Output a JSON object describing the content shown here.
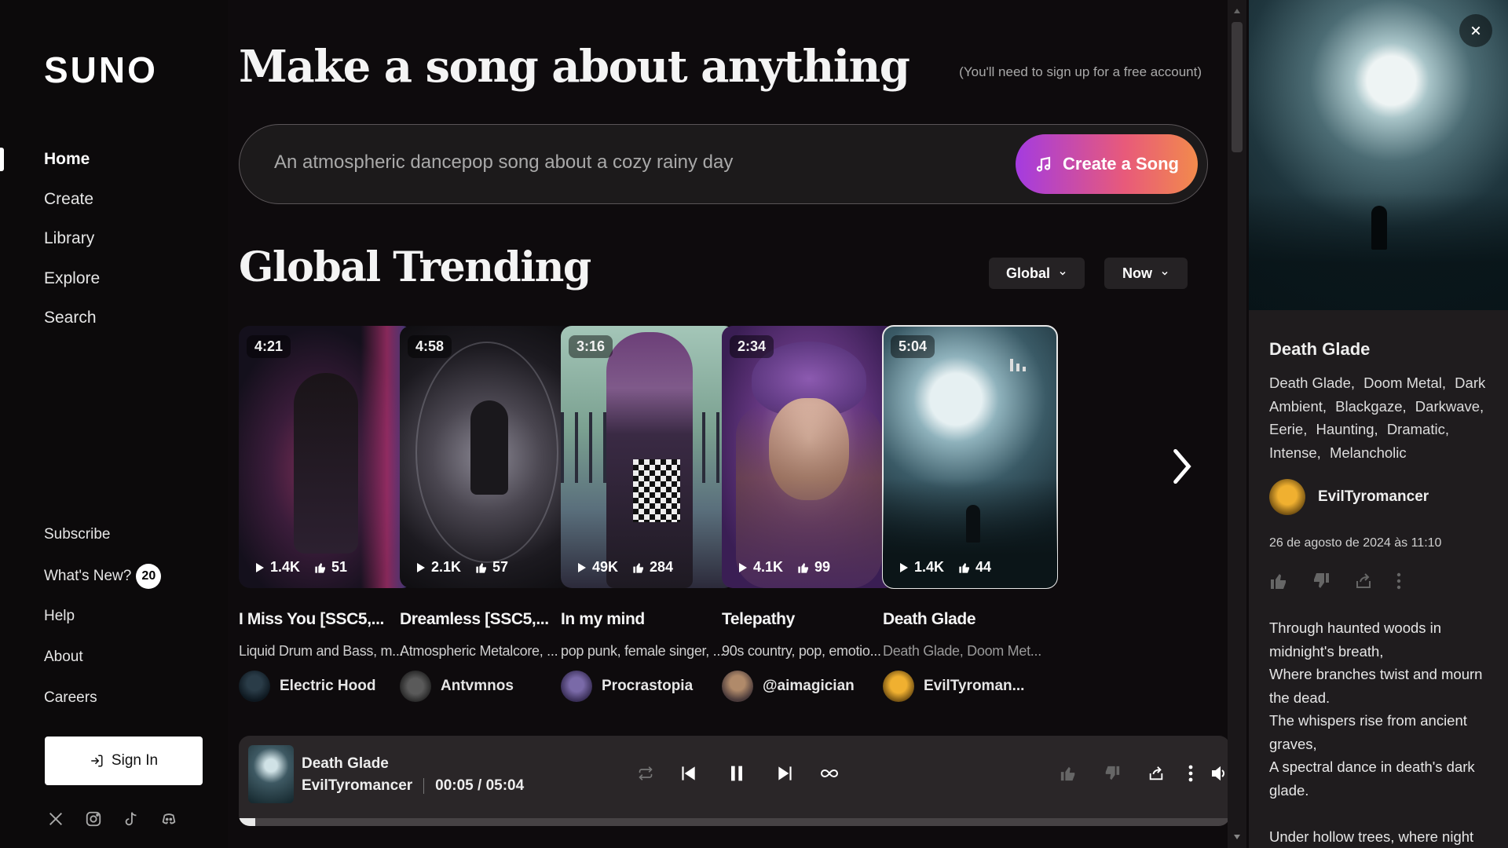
{
  "sidebar": {
    "logo": "SUNO",
    "nav": [
      "Home",
      "Create",
      "Library",
      "Explore",
      "Search"
    ],
    "subscribe": "Subscribe",
    "whats_new": "What's New?",
    "whats_new_count": "20",
    "help": "Help",
    "about": "About",
    "careers": "Careers",
    "sign_in": "Sign In",
    "socials": [
      "x-icon",
      "instagram-icon",
      "tiktok-icon",
      "discord-icon"
    ]
  },
  "hero": {
    "title": "Make a song about anything",
    "hint": "(You'll need to sign up for a free account)",
    "prompt_placeholder": "An atmospheric dancepop song about a cozy rainy day",
    "create_button": "Create a Song"
  },
  "trending": {
    "title": "Global Trending",
    "filter_region": "Global",
    "filter_time": "Now",
    "cards": [
      {
        "duration": "4:21",
        "plays": "1.4K",
        "likes": "51",
        "title": "I Miss You [SSC5,...",
        "desc": "Liquid Drum and Bass, m...",
        "user": "Electric Hood"
      },
      {
        "duration": "4:58",
        "plays": "2.1K",
        "likes": "57",
        "title": "Dreamless [SSC5,...",
        "desc": "Atmospheric Metalcore, ...",
        "user": "Antvmnos"
      },
      {
        "duration": "3:16",
        "plays": "49K",
        "likes": "284",
        "title": "In my mind",
        "desc": "pop punk, female singer, ...",
        "user": "Procrastopia"
      },
      {
        "duration": "2:34",
        "plays": "4.1K",
        "likes": "99",
        "title": "Telepathy",
        "desc": "90s country, pop, emotio...",
        "user": "@aimagician"
      },
      {
        "duration": "5:04",
        "plays": "1.4K",
        "likes": "44",
        "title": "Death Glade",
        "desc": "Death Glade, Doom Met...",
        "user": "EvilTyroman..."
      }
    ]
  },
  "player": {
    "title": "Death Glade",
    "artist": "EvilTyromancer",
    "time": "00:05 / 05:04",
    "progress": 0.0164
  },
  "panel": {
    "title": "Death Glade",
    "tags": [
      "Death Glade,",
      "Doom Metal,",
      "Dark Ambient,",
      "Blackgaze,",
      "Darkwave,",
      "Eerie,",
      "Haunting,",
      "Dramatic,",
      "Intense,",
      "Melancholic"
    ],
    "user": "EvilTyromancer",
    "date": "26 de agosto de 2024 às 11:10",
    "lyrics": "Through haunted woods in midnight's breath,\nWhere branches twist and mourn the dead.\nThe whispers rise from ancient graves,\nA spectral dance in death's dark glade.\n\nUnder hollow trees, where night"
  }
}
